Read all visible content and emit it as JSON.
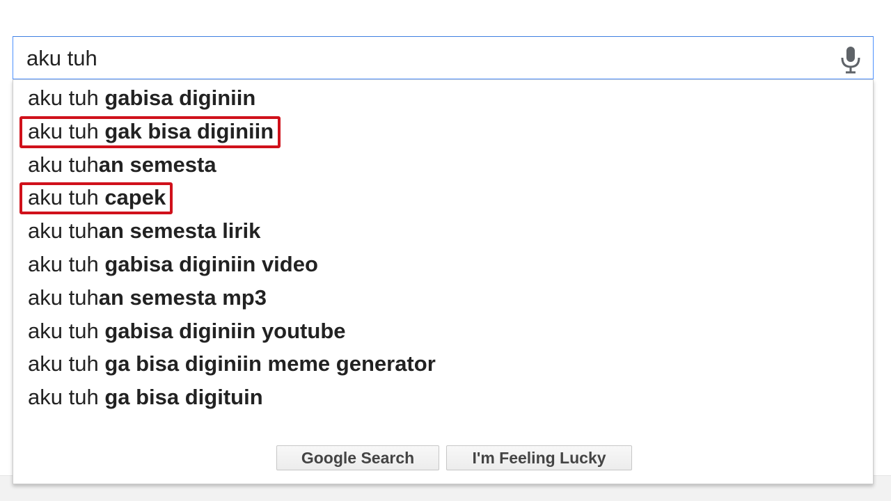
{
  "search": {
    "query": "aku tuh",
    "mic_icon": "microphone-icon"
  },
  "suggestions": [
    {
      "typed": "aku tuh ",
      "completion": "gabisa diginiin"
    },
    {
      "typed": "aku tuh ",
      "completion": "gak bisa diginiin"
    },
    {
      "typed": "aku tuh",
      "completion": "an semesta"
    },
    {
      "typed": "aku tuh ",
      "completion": "capek"
    },
    {
      "typed": "aku tuh",
      "completion": "an semesta lirik"
    },
    {
      "typed": "aku tuh ",
      "completion": "gabisa diginiin video"
    },
    {
      "typed": "aku tuh",
      "completion": "an semesta mp3"
    },
    {
      "typed": "aku tuh ",
      "completion": "gabisa diginiin youtube"
    },
    {
      "typed": "aku tuh ",
      "completion": "ga bisa diginiin meme generator"
    },
    {
      "typed": "aku tuh ",
      "completion": "ga bisa digituin"
    }
  ],
  "highlighted_suggestions": [
    1,
    3
  ],
  "buttons": {
    "search_label": "Google Search",
    "lucky_label": "I'm Feeling Lucky"
  },
  "colors": {
    "focus_border": "#4d90fe",
    "highlight": "#d0111b",
    "text": "#222222"
  }
}
